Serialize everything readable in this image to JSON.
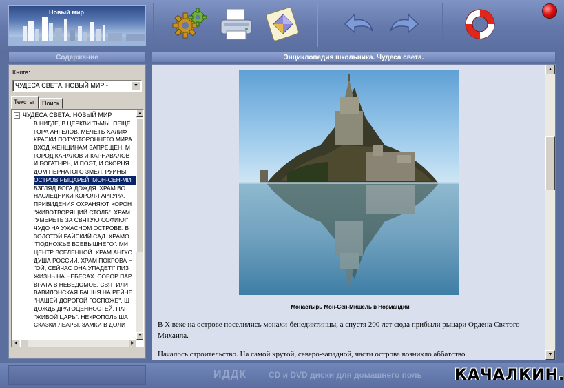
{
  "toolbar": {
    "logo_title": "Новый мир",
    "buttons": [
      {
        "name": "settings-button",
        "icon": "gears-icon"
      },
      {
        "name": "print-button",
        "icon": "printer-icon"
      },
      {
        "name": "bookmark-button",
        "icon": "diamond-note-icon"
      },
      {
        "name": "back-button",
        "icon": "arrow-back-icon"
      },
      {
        "name": "forward-button",
        "icon": "arrow-forward-icon"
      },
      {
        "name": "help-button",
        "icon": "lifebuoy-icon"
      }
    ]
  },
  "left_panel": {
    "title": "Содержание",
    "book_label": "Книга:",
    "book_selected": "ЧУДЕСА СВЕТА. НОВЫЙ МИР -",
    "tabs": [
      "Тексты",
      "Поиск"
    ],
    "tree_root": "ЧУДЕСА СВЕТА.  НОВЫЙ МИР",
    "selected_index": 8,
    "tree_items": [
      "В НИГДЕ, В ЦЕРКВИ ТЬМЫ.  ПЕЩЕ",
      "ГОРА АНГЕЛОВ.  МЕЧЕТЬ ХАЛИФ",
      "КРАСКИ ПОТУСТОРОННЕГО МИРА",
      "ВХОД ЖЕНЩИНАМ ЗАПРЕЩЕН.  М",
      "ГОРОД КАНАЛОВ И КАРНАВАЛОВ",
      "И БОГАТЫРЬ, И ПОЭТ, И СКОРНЯ",
      "ДОМ ПЕРНАТОГО ЗМЕЯ.  РУИНЫ",
      "ОСТРОВ РЫЦАРЕЙ.  МОН-СЕН-МИ",
      "ВЗГЛЯД БОГА ДОЖДЯ.  ХРАМ ВО",
      "НАСЛЕДНИКИ КОРОЛЯ АРТУРА.",
      "ПРИВИДЕНИЯ ОХРАНЯЮТ КОРОН",
      "\"ЖИВОТВОРЯЩИЙ СТОЛБ\".  ХРАМ",
      "\"УМЕРЕТЬ ЗА СВЯТУЮ СОФИЮ!\"",
      "ЧУДО НА УЖАСНОМ ОСТРОВЕ.  В",
      "ЗОЛОТОЙ РАЙСКИЙ САД.  ХРАМО",
      "\"ПОДНОЖЬЕ ВСЕВЫШНЕГО\".  МИ",
      "ЦЕНТР ВСЕЛЕННОЙ.  ХРАМ АНГКО",
      "ДУША РОССИИ.  ХРАМ ПОКРОВА Н",
      "\"ОЙ, СЕЙЧАС ОНА УПАДЕТ!\"  ПИЗ",
      "ЖИЗНЬ НА НЕБЕСАХ.  СОБОР ПАР",
      "ВРАТА В НЕВЕДОМОЕ.  СВЯТИЛИ",
      "ВАВИЛОНСКАЯ БАШНЯ НА РЕЙНЕ",
      "\"НАШЕЙ ДОРОГОЙ ГОСПОЖЕ\".  Ш",
      "ДОЖДЬ ДРАГОЦЕННОСТЕЙ.  ПАГ",
      "\"ЖИВОЙ ЦАРЬ\".  НЕКРОПОЛЬ ША",
      "СКАЗКИ ЛЬАРЫ.  ЗАМКИ В ДОЛИ"
    ]
  },
  "content": {
    "title": "Энциклопедия школьника. Чудеса света.",
    "image_alt_icon": "mont-saint-michel-photo",
    "caption": "Монастырь Мон-Сен-Мишель в Нормандии",
    "paragraphs": [
      "В X веке на острове поселились монахи-бенедиктинцы, а спустя 200 лет сюда прибыли рыцари Ордена Святого Михаила.",
      "Началось строительство. На самой крутой, северо-западной, части острова возникло аббатство."
    ]
  },
  "statusbar": {
    "brand": "ИДДК",
    "tagline": "CD и DVD диски для домашнего поль",
    "watermark": "КАЧАЛКИН.РУ"
  },
  "colors": {
    "toolbar": "#6478ab",
    "selection": "#0a246a",
    "content_bg": "#dadfed"
  }
}
